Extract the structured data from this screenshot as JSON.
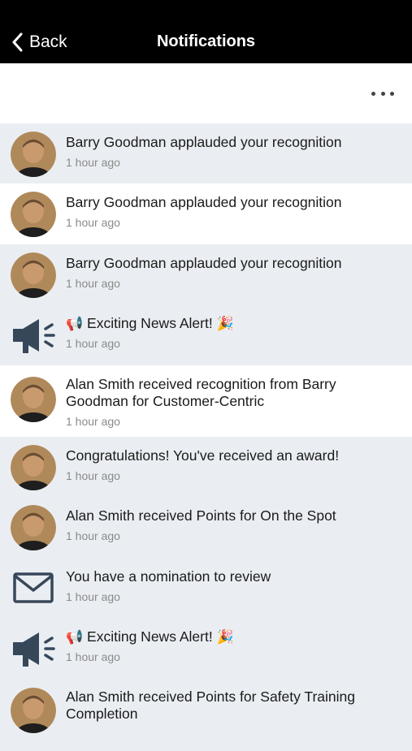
{
  "nav": {
    "back_label": "Back",
    "title": "Notifications"
  },
  "notifications": [
    {
      "title": "Barry Goodman applauded your recognition",
      "time": "1 hour ago"
    },
    {
      "title": "Barry Goodman applauded your recognition",
      "time": "1 hour ago"
    },
    {
      "title": "Barry Goodman applauded your recognition",
      "time": "1 hour ago"
    },
    {
      "title": "Exciting News Alert!",
      "time": "1 hour ago"
    },
    {
      "title": "Alan Smith received recognition from Barry Goodman for Customer-Centric",
      "time": "1 hour ago"
    },
    {
      "title": "Congratulations! You've received an award!",
      "time": "1 hour ago"
    },
    {
      "title": "Alan Smith received Points for On the Spot",
      "time": "1 hour ago"
    },
    {
      "title": "You have a nomination to review",
      "time": "1 hour ago"
    },
    {
      "title": "Exciting News Alert!",
      "time": "1 hour ago"
    },
    {
      "title": "Alan Smith received Points for Safety Training Completion",
      "time": ""
    }
  ],
  "icons": {
    "back": "chevron-left-icon",
    "more": "more-horizontal-icon",
    "avatar": "user-avatar",
    "announcement": "megaphone-icon",
    "message": "envelope-icon",
    "emoji_left": "📢",
    "emoji_right": "🎉"
  },
  "colors": {
    "nav_bg": "#000000",
    "row_shaded": "#eaeef2",
    "row_white": "#ffffff",
    "icon": "#37475a",
    "time_text": "#8a8a8a"
  }
}
